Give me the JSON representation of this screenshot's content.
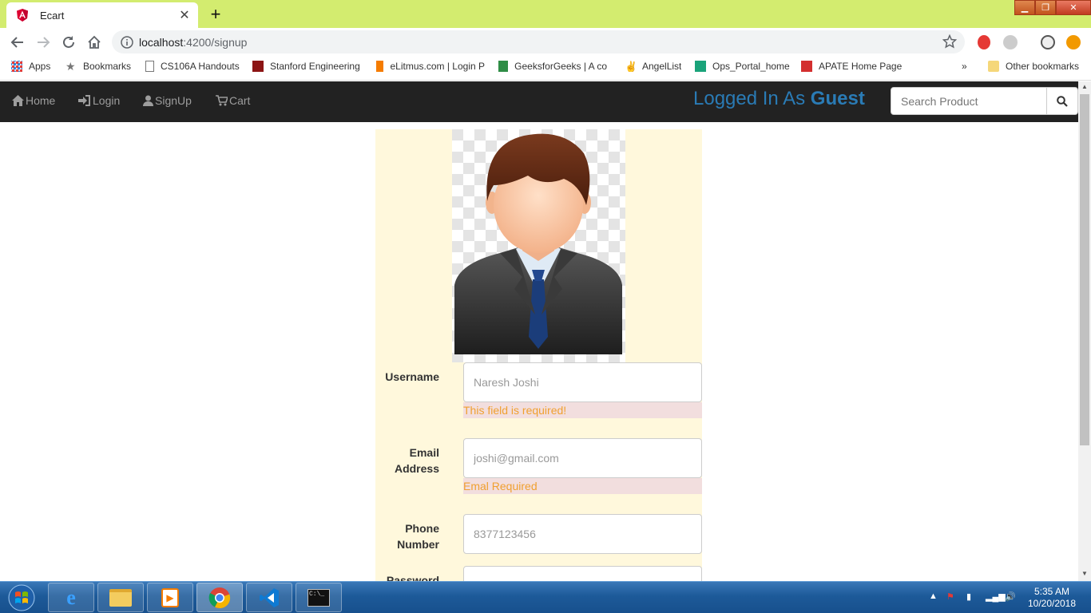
{
  "browser": {
    "tab_title": "Ecart",
    "url_host": "localhost",
    "url_path": ":4200/signup",
    "bookmarks": [
      {
        "label": "Apps",
        "icon": "apps-grid-icon"
      },
      {
        "label": "Bookmarks",
        "icon": "star-icon"
      },
      {
        "label": "CS106A Handouts",
        "icon": "page-icon"
      },
      {
        "label": "Stanford Engineering",
        "icon": "stanford-icon"
      },
      {
        "label": "eLitmus.com | Login P",
        "icon": "elitmus-icon"
      },
      {
        "label": "GeeksforGeeks | A co",
        "icon": "gfg-icon"
      },
      {
        "label": "AngelList",
        "icon": "angellist-icon"
      },
      {
        "label": "Ops_Portal_home",
        "icon": "ops-icon"
      },
      {
        "label": "APATE Home Page",
        "icon": "apate-icon"
      }
    ],
    "overflow_label": "»",
    "other_bookmarks": "Other bookmarks"
  },
  "appnav": {
    "home": "Home",
    "login": "Login",
    "signup": "SignUp",
    "cart": "Cart",
    "logged_prefix": "Logged In As ",
    "logged_user": "Guest",
    "search_placeholder": "Search Product"
  },
  "form": {
    "username_label": "Username",
    "username_placeholder": "Naresh Joshi",
    "username_error": "This field is required!",
    "email_label_1": "Email",
    "email_label_2": "Address",
    "email_placeholder": "joshi@gmail.com",
    "email_error": "Emal Required",
    "phone_label_1": "Phone",
    "phone_label_2": "Number",
    "phone_placeholder": "8377123456",
    "password_label": "Password"
  },
  "taskbar": {
    "time": "5:35 AM",
    "date": "10/20/2018"
  },
  "colors": {
    "chrome_frame": "#d3ec6f",
    "navbar": "#222222",
    "logged_text": "#2a7bb5",
    "panel_bg": "#fff8dc",
    "error_bg": "#f2dede",
    "error_text": "#f0a030"
  }
}
